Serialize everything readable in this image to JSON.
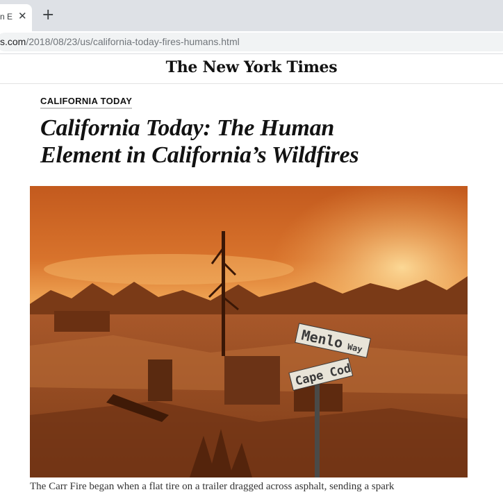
{
  "browser": {
    "tab_title": "n E",
    "close_icon": "close-icon",
    "new_tab_icon": "plus-icon",
    "url_host": "s.com",
    "url_path": "/2018/08/23/us/california-today-fires-humans.html"
  },
  "site": {
    "logo_text": "The New York Times"
  },
  "article": {
    "kicker": "CALIFORNIA TODAY",
    "headline_line1": "California Today: The Human",
    "headline_line2": "Element in California’s Wildfires",
    "photo": {
      "sign_upper": "Menlo",
      "sign_upper_suffix": "Way",
      "sign_lower": "Cape Cod"
    },
    "caption": "The Carr Fire began when a flat tire on a trailer dragged across asphalt, sending a spark"
  }
}
